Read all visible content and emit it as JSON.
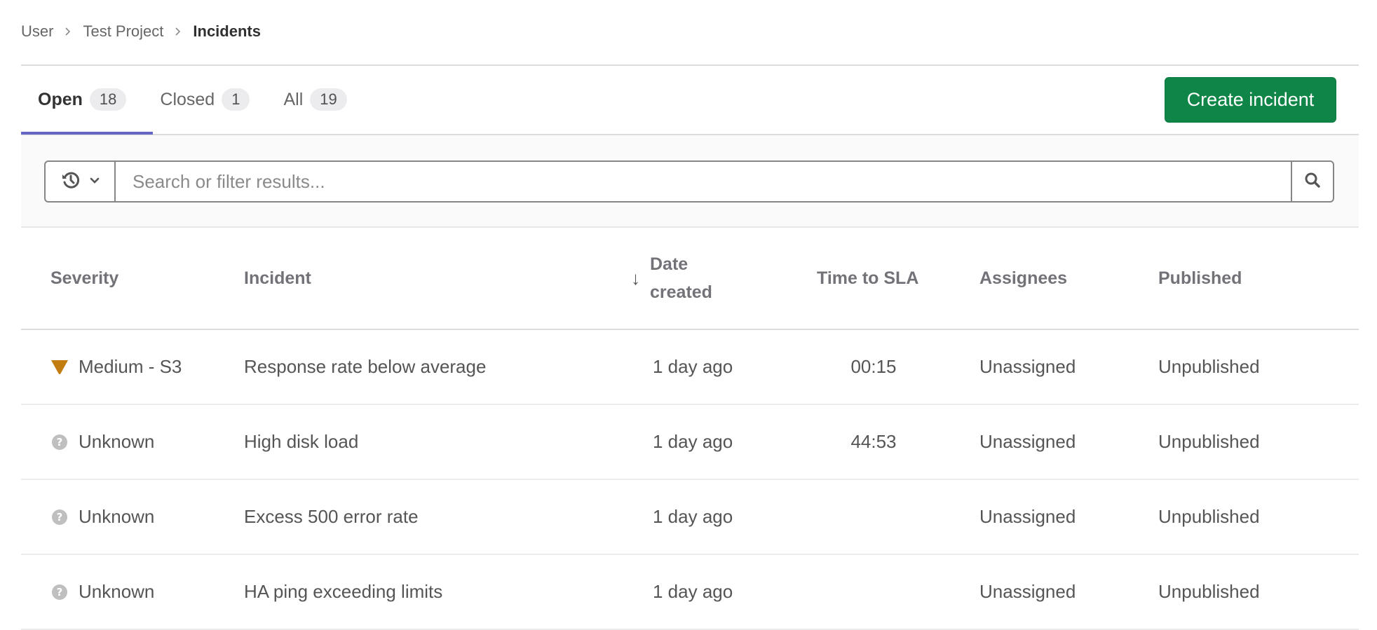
{
  "breadcrumb": [
    {
      "label": "User"
    },
    {
      "label": "Test Project"
    },
    {
      "label": "Incidents"
    }
  ],
  "tabs": [
    {
      "label": "Open",
      "count": "18",
      "active": true
    },
    {
      "label": "Closed",
      "count": "1",
      "active": false
    },
    {
      "label": "All",
      "count": "19",
      "active": false
    }
  ],
  "actions": {
    "create_incident_label": "Create incident"
  },
  "filter": {
    "placeholder": "Search or filter results...",
    "value": "",
    "history_icon": "history-icon",
    "search_icon": "search-icon"
  },
  "colors": {
    "accent_tab": "#6666c4",
    "primary_button": "#108548",
    "severity_medium": "#c17d10",
    "severity_unknown": "#bfbfbf"
  },
  "table": {
    "columns": {
      "severity": "Severity",
      "incident": "Incident",
      "date_created": "Date created",
      "time_to_sla": "Time to SLA",
      "assignees": "Assignees",
      "published": "Published"
    },
    "sort": {
      "column": "date_created",
      "direction": "descending",
      "icon": "arrow-down-icon"
    },
    "rows": [
      {
        "severity": "Medium - S3",
        "severity_icon": "severity-medium-icon",
        "incident": "Response rate below average",
        "date_created": "1 day ago",
        "time_to_sla": "00:15",
        "assignees": "Unassigned",
        "published": "Unpublished"
      },
      {
        "severity": "Unknown",
        "severity_icon": "severity-unknown-icon",
        "incident": "High disk load",
        "date_created": "1 day ago",
        "time_to_sla": "44:53",
        "assignees": "Unassigned",
        "published": "Unpublished"
      },
      {
        "severity": "Unknown",
        "severity_icon": "severity-unknown-icon",
        "incident": "Excess 500 error rate",
        "date_created": "1 day ago",
        "time_to_sla": "",
        "assignees": "Unassigned",
        "published": "Unpublished"
      },
      {
        "severity": "Unknown",
        "severity_icon": "severity-unknown-icon",
        "incident": "HA ping exceeding limits",
        "date_created": "1 day ago",
        "time_to_sla": "",
        "assignees": "Unassigned",
        "published": "Unpublished"
      }
    ]
  }
}
